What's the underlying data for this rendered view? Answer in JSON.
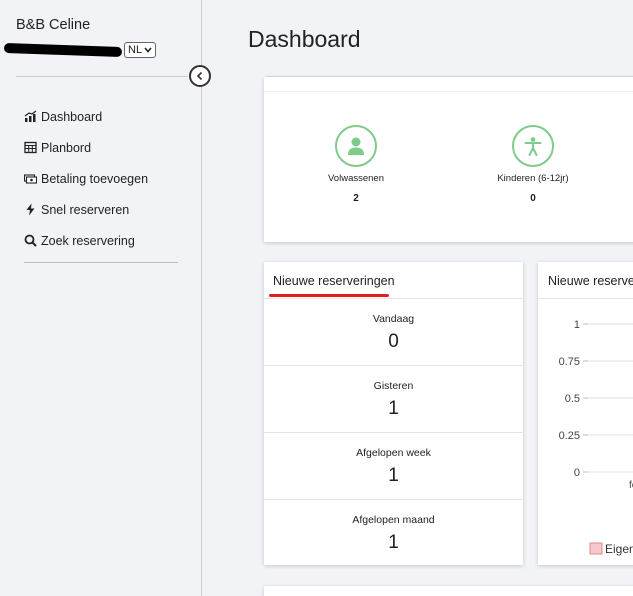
{
  "sidebar": {
    "brand": "B&B Celine",
    "language": "NL",
    "nav": [
      {
        "label": "Dashboard",
        "icon": "bar-chart-icon"
      },
      {
        "label": "Planbord",
        "icon": "calendar-grid-icon"
      },
      {
        "label": "Betaling toevoegen",
        "icon": "money-icon"
      },
      {
        "label": "Snel reserveren",
        "icon": "lightning-icon"
      },
      {
        "label": "Zoek reservering",
        "icon": "search-icon"
      }
    ]
  },
  "main": {
    "title": "Dashboard",
    "guests": [
      {
        "label": "Volwassenen",
        "value": "2",
        "icon": "person-icon"
      },
      {
        "label": "Kinderen (6-12jr)",
        "value": "0",
        "icon": "child-icon"
      }
    ],
    "reservations": {
      "title": "Nieuwe reserveringen",
      "stats": [
        {
          "label": "Vandaag",
          "value": "0"
        },
        {
          "label": "Gisteren",
          "value": "1"
        },
        {
          "label": "Afgelopen week",
          "value": "1"
        },
        {
          "label": "Afgelopen maand",
          "value": "1"
        }
      ]
    },
    "chart_card": {
      "title": "Nieuwe reserver",
      "legend_label": "Eigen",
      "legend_color": "#f7c6cf",
      "x_tick": "fe"
    }
  },
  "chart_data": {
    "type": "bar",
    "title": "Nieuwe reserver",
    "xlabel": "",
    "ylabel": "",
    "ylim": [
      0,
      1
    ],
    "y_ticks": [
      "1",
      "0.75",
      "0.5",
      "0.25",
      "0"
    ],
    "categories": [
      "fe"
    ],
    "series": [
      {
        "name": "Eigen",
        "values": [],
        "color": "#f7c6cf"
      }
    ],
    "grid": true,
    "legend": "bottom"
  }
}
